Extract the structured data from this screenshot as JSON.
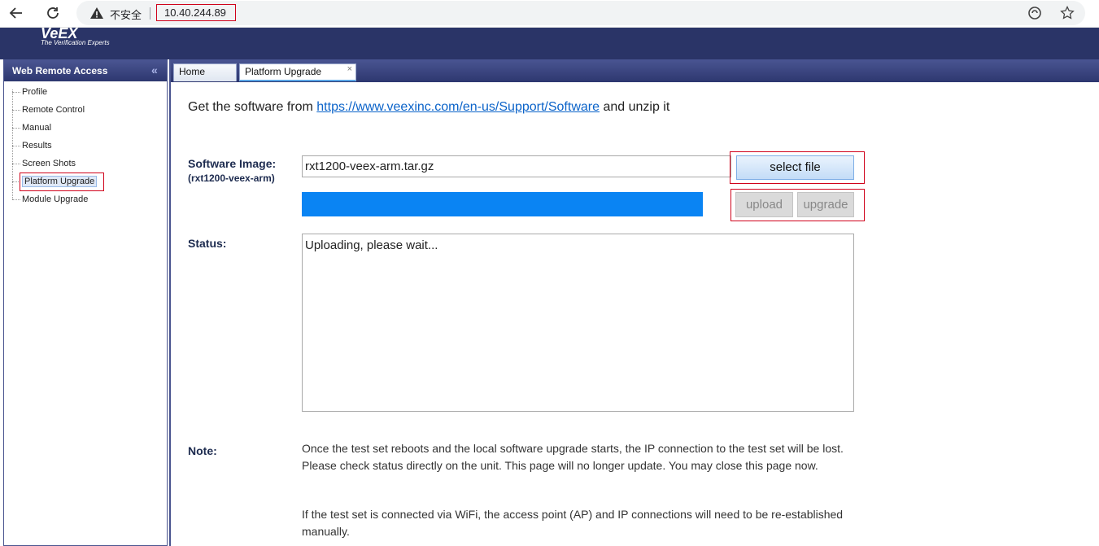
{
  "browser": {
    "security_text": "不安全",
    "url": "10.40.244.89",
    "icons": [
      "back-icon",
      "reload-icon",
      "warning-icon",
      "edge-refresh-icon",
      "favorite-star-icon"
    ]
  },
  "header": {
    "logo_text": "VeEX",
    "logo_tagline": "The Verification Experts"
  },
  "sidebar": {
    "title": "Web Remote Access",
    "collapse_icon": "«",
    "items": [
      {
        "label": "Profile"
      },
      {
        "label": "Remote Control"
      },
      {
        "label": "Manual"
      },
      {
        "label": "Results"
      },
      {
        "label": "Screen Shots"
      },
      {
        "label": "Platform Upgrade",
        "active": true
      },
      {
        "label": "Module Upgrade"
      }
    ]
  },
  "tabs": [
    {
      "label": "Home"
    },
    {
      "label": "Platform Upgrade",
      "active": true,
      "close": "×"
    }
  ],
  "main": {
    "intro_prefix": "Get the software from ",
    "intro_link": "https://www.veexinc.com/en-us/Support/Software",
    "intro_suffix": " and unzip it",
    "software_label": "Software Image:",
    "software_sublabel": "(rxt1200-veex-arm)",
    "file_value": "rxt1200-veex-arm.tar.gz",
    "select_button": "select file",
    "upload_button": "upload",
    "upgrade_button": "upgrade",
    "progress": 1.0,
    "status_label": "Status:",
    "status_text": "Uploading, please wait...",
    "note_label": "Note:",
    "note_p1": "Once the test set reboots and the local software upgrade starts, the IP connection to the test set will be lost. Please check status directly on the unit. This page will no longer update. You may close this page now.",
    "note_p2": "If the test set is connected via WiFi, the access point (AP) and IP connections will need to be re-established manually."
  },
  "colors": {
    "header_bg": "#2a3467",
    "progress_fill": "#0a84f3",
    "highlight_border": "#d0021b",
    "link": "#0b63c9"
  }
}
